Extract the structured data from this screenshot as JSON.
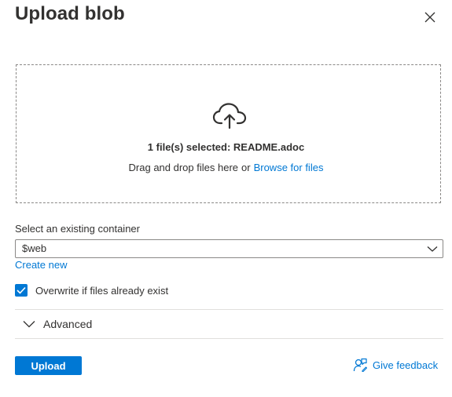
{
  "panel": {
    "title": "Upload blob"
  },
  "dropzone": {
    "selected_text": "1 file(s) selected: README.adoc",
    "drag_text": "Drag and drop files here",
    "or_text": "or",
    "browse_link": "Browse for files",
    "icon": "cloud-upload-icon"
  },
  "container": {
    "label": "Select an existing container",
    "selected_value": "$web",
    "create_new_link": "Create new"
  },
  "overwrite": {
    "label": "Overwrite if files already exist",
    "checked": true
  },
  "advanced": {
    "label": "Advanced",
    "expanded": false
  },
  "footer": {
    "upload_label": "Upload",
    "feedback_label": "Give feedback",
    "feedback_icon": "feedback-person-icon"
  },
  "colors": {
    "accent": "#0078d4",
    "text": "#323130",
    "border": "#8a8886",
    "divider": "#e1dfdd"
  }
}
